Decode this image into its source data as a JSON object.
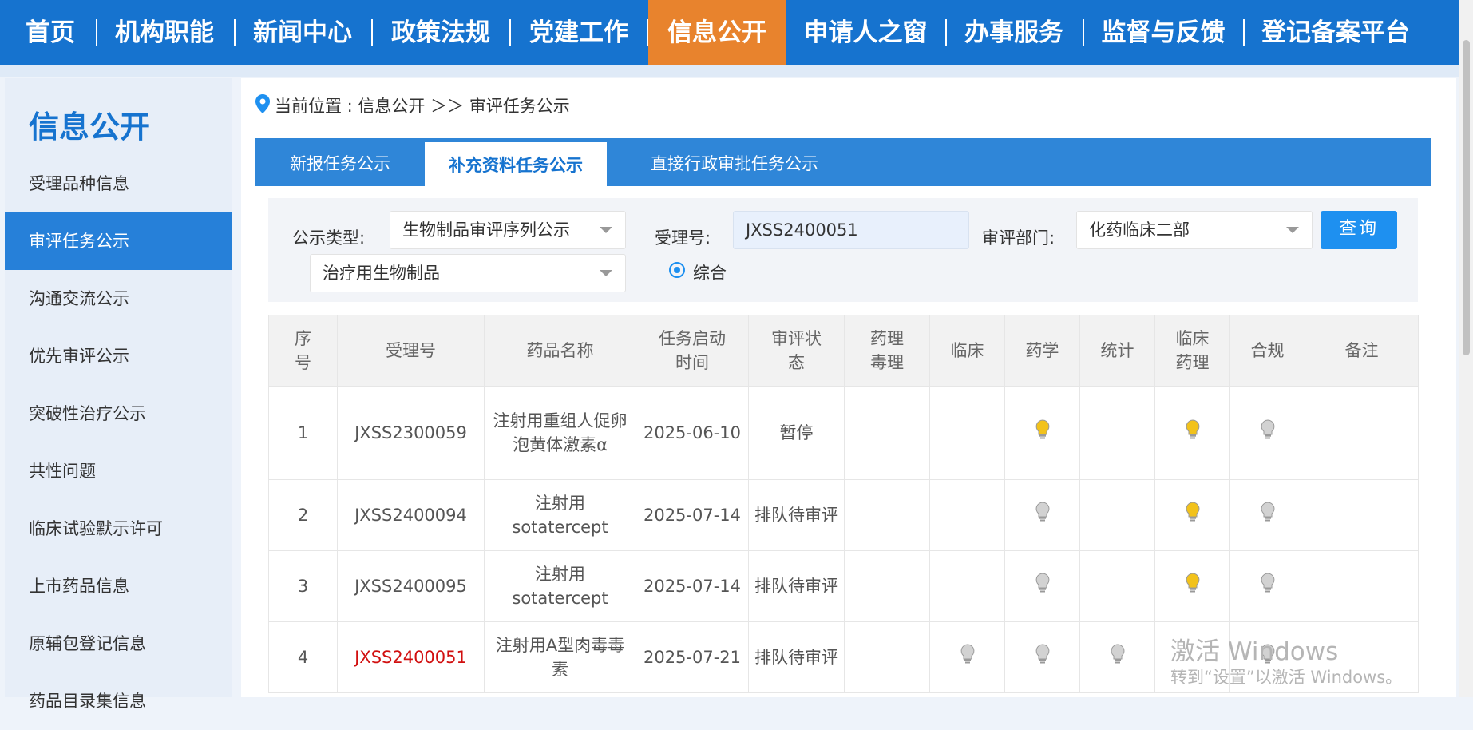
{
  "nav": {
    "items": [
      "首页",
      "机构职能",
      "新闻中心",
      "政策法规",
      "党建工作",
      "信息公开",
      "申请人之窗",
      "办事服务",
      "监督与反馈",
      "登记备案平台"
    ],
    "active": "信息公开",
    "colors": {
      "bar": "#1673cf",
      "active": "#e8832d"
    }
  },
  "sidebar": {
    "title": "信息公开",
    "items": [
      "受理品种信息",
      "审评任务公示",
      "沟通交流公示",
      "优先审评公示",
      "突破性治疗公示",
      "共性问题",
      "临床试验默示许可",
      "上市药品信息",
      "原辅包登记信息",
      "药品目录集信息"
    ],
    "active": "审评任务公示"
  },
  "breadcrumb": {
    "text": "当前位置 : 信息公开 ＞＞ 审评任务公示",
    "icon": "location-pin-icon"
  },
  "tabs": [
    "新报任务公示",
    "补充资料任务公示",
    "直接行政审批任务公示"
  ],
  "active_tab": "补充资料任务公示",
  "filter": {
    "type_label": "公示类型:",
    "type_value": "生物制品审评序列公示",
    "subtype_value": "治疗用生物制品",
    "acceptance_label": "受理号:",
    "acceptance_value": "JXSS2400051",
    "dept_label": "审评部门:",
    "dept_value": "化药临床二部",
    "query_button": "查询",
    "radio_label": "综合"
  },
  "table": {
    "headers": [
      "序\n号",
      "受理号",
      "药品名称",
      "任务启动\n时间",
      "审评状\n态",
      "药理\n毒理",
      "临床",
      "药学",
      "统计",
      "临床\n药理",
      "合规",
      "备注"
    ],
    "rows": [
      {
        "seq": "1",
        "acceptance": "JXSS2300059",
        "name": "注射用重组人促卵泡黄体激素α",
        "date": "2025-06-10",
        "status": "暂停",
        "bulbs": [
          "none",
          "none",
          "yellow",
          "none",
          "yellow",
          "gray"
        ],
        "highlight": false
      },
      {
        "seq": "2",
        "acceptance": "JXSS2400094",
        "name": "注射用 sotatercept",
        "date": "2025-07-14",
        "status": "排队待审评",
        "bulbs": [
          "none",
          "none",
          "gray",
          "none",
          "yellow",
          "gray"
        ],
        "highlight": false
      },
      {
        "seq": "3",
        "acceptance": "JXSS2400095",
        "name": "注射用 sotatercept",
        "date": "2025-07-14",
        "status": "排队待审评",
        "bulbs": [
          "none",
          "none",
          "gray",
          "none",
          "yellow",
          "gray"
        ],
        "highlight": false
      },
      {
        "seq": "4",
        "acceptance": "JXSS2400051",
        "name": "注射用A型肉毒毒素",
        "date": "2025-07-21",
        "status": "排队待审评",
        "bulbs": [
          "none",
          "gray",
          "gray",
          "gray",
          "none",
          "gray"
        ],
        "highlight": true
      }
    ],
    "colors": {
      "bulb_yellow": "#f2c21b",
      "bulb_gray": "#d2d2d2",
      "highlight": "#d10f0f"
    }
  },
  "watermark": {
    "line1": "激活 Windows",
    "line2": "转到“设置”以激活 Windows。"
  }
}
